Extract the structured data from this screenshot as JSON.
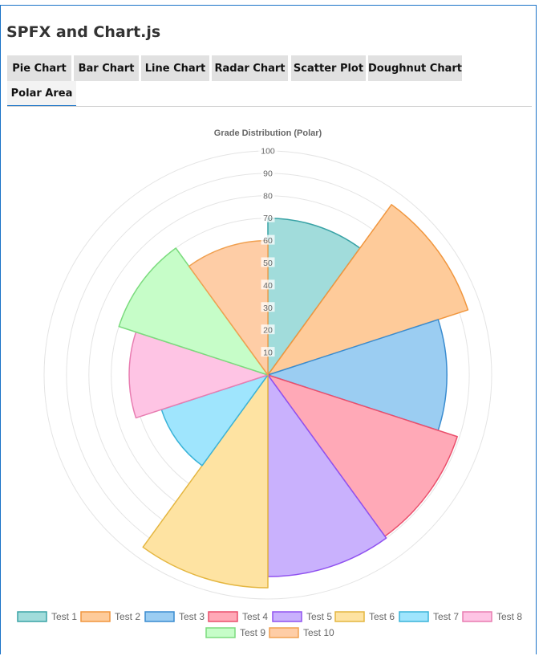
{
  "app": {
    "title": "SPFX and Chart.js"
  },
  "tabs": [
    {
      "label": "Pie Chart",
      "active": false
    },
    {
      "label": "Bar Chart",
      "active": false
    },
    {
      "label": "Line Chart",
      "active": false
    },
    {
      "label": "Radar Chart",
      "active": false
    },
    {
      "label": "Scatter Plot",
      "active": false
    },
    {
      "label": "Doughnut Chart",
      "active": false
    },
    {
      "label": "Polar Area",
      "active": true
    }
  ],
  "chart_data": {
    "type": "polarArea",
    "title": "Grade Distribution (Polar)",
    "categories": [
      "Test 1",
      "Test 2",
      "Test 3",
      "Test 4",
      "Test 5",
      "Test 6",
      "Test 7",
      "Test 8",
      "Test 9",
      "Test 10"
    ],
    "values": [
      70,
      94,
      80,
      89,
      90,
      95,
      50,
      62,
      70,
      60
    ],
    "r_range": [
      0,
      100
    ],
    "r_ticks": [
      10,
      20,
      30,
      40,
      50,
      60,
      70,
      80,
      90,
      100
    ],
    "grid": true,
    "legend_position": "bottom",
    "colors": [
      {
        "fill": "#a1dcdb",
        "stroke": "#3aa3a6"
      },
      {
        "fill": "#fecb9a",
        "stroke": "#f0963e"
      },
      {
        "fill": "#9bcdf2",
        "stroke": "#3a8cd0"
      },
      {
        "fill": "#ffa9b7",
        "stroke": "#ea4f6c"
      },
      {
        "fill": "#c9b1fd",
        "stroke": "#9052f0"
      },
      {
        "fill": "#fee3a2",
        "stroke": "#e4b640"
      },
      {
        "fill": "#9fe5fd",
        "stroke": "#3ab3d8"
      },
      {
        "fill": "#fec4e4",
        "stroke": "#e87db1"
      },
      {
        "fill": "#c6fdc8",
        "stroke": "#7bdb7e"
      },
      {
        "fill": "#fecda6",
        "stroke": "#f0a050"
      }
    ]
  }
}
